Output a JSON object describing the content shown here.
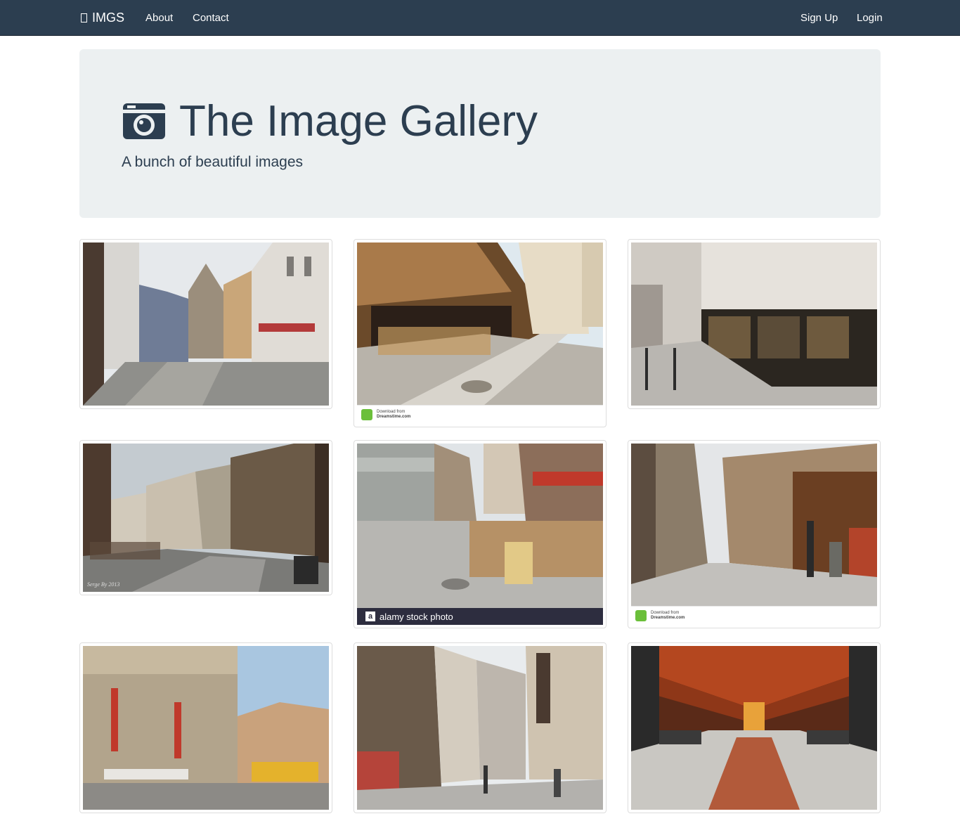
{
  "navbar": {
    "brand": "IMGS",
    "links": [
      "About",
      "Contact"
    ],
    "right_links": [
      "Sign Up",
      "Login"
    ]
  },
  "jumbotron": {
    "icon": "camera-icon",
    "title": "The Image Gallery",
    "subtitle": "A bunch of beautiful images"
  },
  "gallery": {
    "images": [
      {
        "name": "cobblestone street with castle"
      },
      {
        "name": "street cafe terrace",
        "watermark_line1": "Download from",
        "watermark_line2": "Dreamstime.com"
      },
      {
        "name": "shopping street corner"
      },
      {
        "name": "street intersection cafes",
        "caption": "Serge By 2013"
      },
      {
        "name": "busy pedestrian street",
        "watermark": "alamy stock photo"
      },
      {
        "name": "street with statue",
        "watermark_line1": "Download from",
        "watermark_line2": "Dreamstime.com"
      },
      {
        "name": "boulevard with tram"
      },
      {
        "name": "narrow shopping street"
      },
      {
        "name": "great market hall interior"
      }
    ]
  },
  "colors": {
    "navbar": "#2c3e50",
    "jumbotron": "#ecf0f1",
    "text": "#2c3e50"
  }
}
